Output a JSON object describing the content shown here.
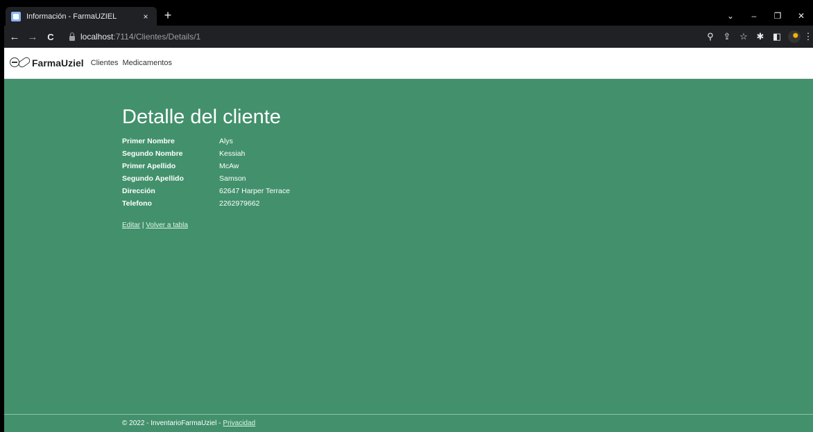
{
  "browser": {
    "tab_title": "Información - FarmaUZIEL",
    "tab_close": "×",
    "new_tab": "+",
    "url_host": "localhost",
    "url_path": ":7114/Clientes/Details/1",
    "window_controls": [
      "⌄",
      "–",
      "❐",
      "✕"
    ],
    "nav": {
      "back": "←",
      "forward": "→",
      "reload": "C"
    },
    "toolbar_icons": [
      "⚲",
      "⇪",
      "☆",
      "✱",
      "◧"
    ]
  },
  "navbar": {
    "brand": "FarmaUziel",
    "links": [
      "Clientes",
      "Medicamentos"
    ]
  },
  "main": {
    "title": "Detalle del cliente",
    "fields": [
      {
        "label": "Primer Nombre",
        "value": "Alys"
      },
      {
        "label": "Segundo Nombre",
        "value": "Kessiah"
      },
      {
        "label": "Primer Apellido",
        "value": "McAw"
      },
      {
        "label": "Segundo Apellido",
        "value": "Samson"
      },
      {
        "label": "Dirección",
        "value": "62647 Harper Terrace"
      },
      {
        "label": "Telefono",
        "value": "2262979662"
      }
    ],
    "edit_link": "Editar",
    "separator": "|",
    "back_link": "Volver a tabla"
  },
  "footer": {
    "text": "© 2022 - InventarioFarmaUziel -",
    "privacy_link": "Privacidad"
  },
  "colors": {
    "page_bg": "#42916c",
    "navbar_bg": "#ffffff",
    "chrome_bg": "#202124"
  }
}
